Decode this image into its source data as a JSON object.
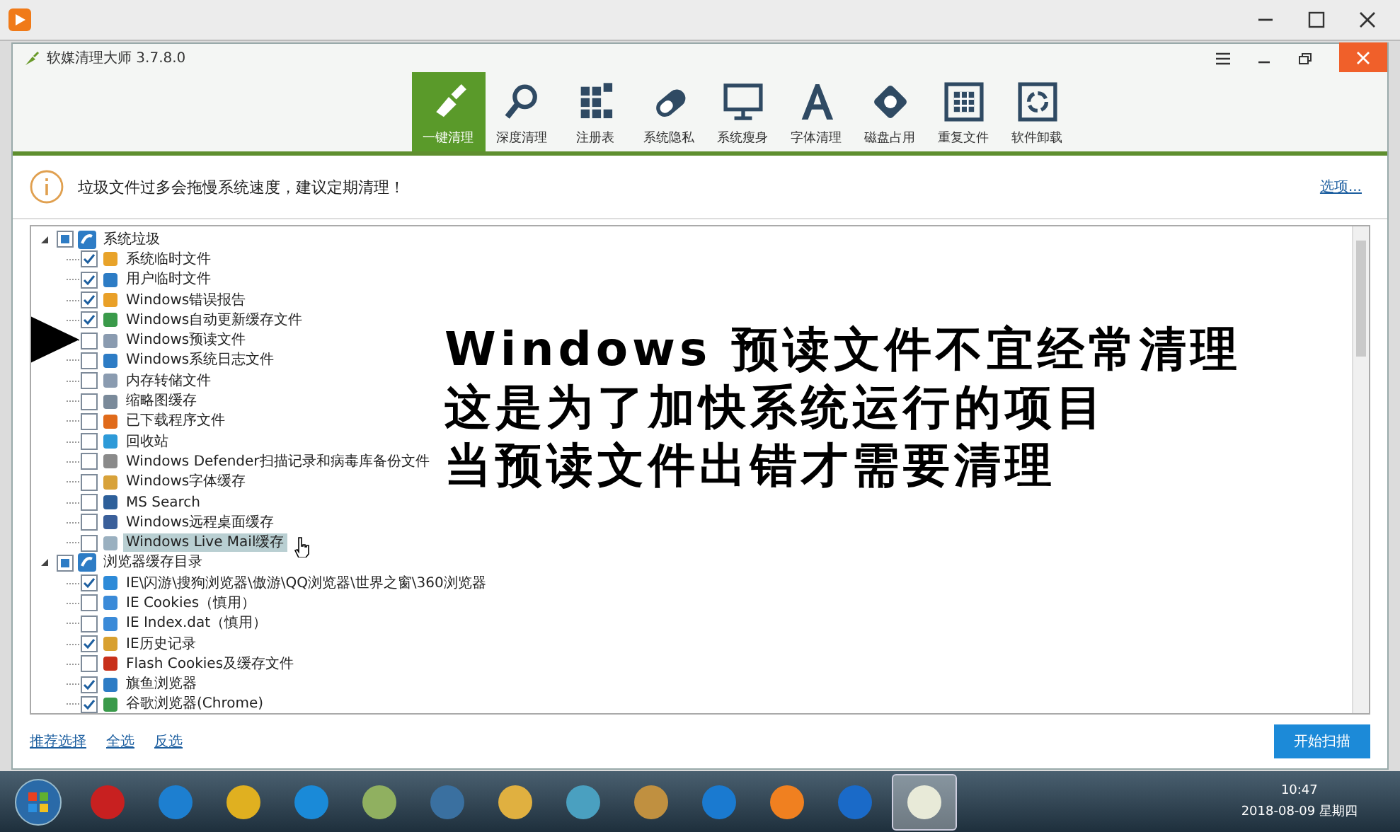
{
  "app": {
    "title": "软媒清理大师 3.7.8.0"
  },
  "tools": [
    {
      "label": "一键清理",
      "selected": true
    },
    {
      "label": "深度清理",
      "selected": false
    },
    {
      "label": "注册表",
      "selected": false
    },
    {
      "label": "系统隐私",
      "selected": false
    },
    {
      "label": "系统瘦身",
      "selected": false
    },
    {
      "label": "字体清理",
      "selected": false
    },
    {
      "label": "磁盘占用",
      "selected": false
    },
    {
      "label": "重复文件",
      "selected": false
    },
    {
      "label": "软件卸载",
      "selected": false
    }
  ],
  "notice": {
    "text": "垃圾文件过多会拖慢系统速度，建议定期清理！",
    "link": "选项..."
  },
  "tree": [
    {
      "label": "系统垃圾",
      "expanded": true,
      "indeterminate": true,
      "children": [
        {
          "label": "系统临时文件",
          "checked": true,
          "selected": false
        },
        {
          "label": "用户临时文件",
          "checked": true,
          "selected": false
        },
        {
          "label": "Windows错误报告",
          "checked": true,
          "selected": false
        },
        {
          "label": "Windows自动更新缓存文件",
          "checked": true,
          "selected": false
        },
        {
          "label": "Windows预读文件",
          "checked": false,
          "selected": false
        },
        {
          "label": "Windows系统日志文件",
          "checked": false,
          "selected": false
        },
        {
          "label": "内存转储文件",
          "checked": false,
          "selected": false
        },
        {
          "label": "缩略图缓存",
          "checked": false,
          "selected": false
        },
        {
          "label": "已下载程序文件",
          "checked": false,
          "selected": false
        },
        {
          "label": "回收站",
          "checked": false,
          "selected": false
        },
        {
          "label": "Windows Defender扫描记录和病毒库备份文件",
          "checked": false,
          "selected": false
        },
        {
          "label": "Windows字体缓存",
          "checked": false,
          "selected": false
        },
        {
          "label": "MS Search",
          "checked": false,
          "selected": false
        },
        {
          "label": "Windows远程桌面缓存",
          "checked": false,
          "selected": false
        },
        {
          "label": "Windows Live Mail缓存",
          "checked": false,
          "selected": true
        }
      ]
    },
    {
      "label": "浏览器缓存目录",
      "expanded": true,
      "indeterminate": true,
      "children": [
        {
          "label": "IE\\闪游\\搜狗浏览器\\傲游\\QQ浏览器\\世界之窗\\360浏览器",
          "checked": true,
          "selected": false
        },
        {
          "label": "IE Cookies（慎用）",
          "checked": false,
          "selected": false
        },
        {
          "label": "IE Index.dat（慎用）",
          "checked": false,
          "selected": false
        },
        {
          "label": "IE历史记录",
          "checked": true,
          "selected": false
        },
        {
          "label": "Flash Cookies及缓存文件",
          "checked": false,
          "selected": false
        },
        {
          "label": "旗鱼浏览器",
          "checked": true,
          "selected": false
        },
        {
          "label": "谷歌浏览器(Chrome)",
          "checked": true,
          "selected": false
        }
      ]
    }
  ],
  "annotation": {
    "lines": [
      "Windows 预读文件不宜经常清理",
      "这是为了加快系统运行的项目",
      "当预读文件出错才需要清理"
    ]
  },
  "footer": {
    "links": [
      "推荐选择",
      "全选",
      "反选"
    ],
    "scan_button": "开始扫描"
  },
  "taskbar": {
    "apps": [
      {
        "selected": false
      },
      {
        "selected": false
      },
      {
        "selected": false
      },
      {
        "selected": false
      },
      {
        "selected": false
      },
      {
        "selected": false
      },
      {
        "selected": false
      },
      {
        "selected": false
      },
      {
        "selected": false
      },
      {
        "selected": false
      },
      {
        "selected": false
      },
      {
        "selected": false
      },
      {
        "selected": true
      }
    ],
    "time": "10:47",
    "date": "2018-08-09 星期四"
  }
}
